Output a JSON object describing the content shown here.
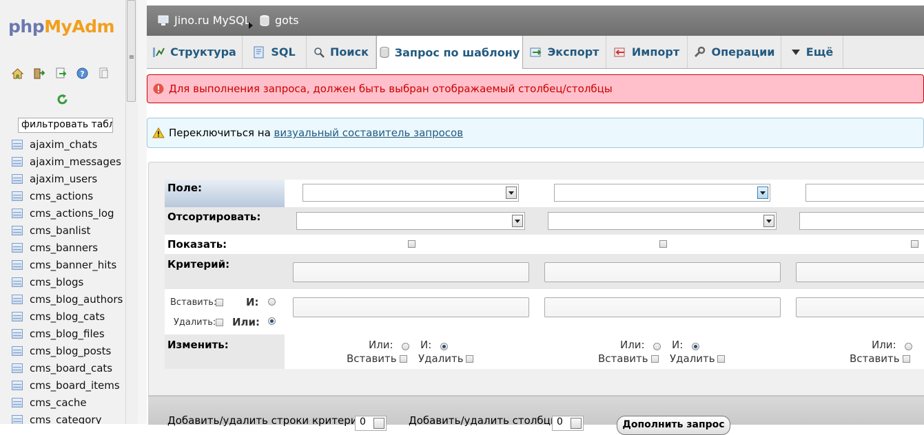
{
  "logo": {
    "part1": "php",
    "part2": "MyAdm"
  },
  "nav": {
    "filter_value": "фильтровать табл",
    "tables": [
      "ajaxim_chats",
      "ajaxim_messages",
      "ajaxim_users",
      "cms_actions",
      "cms_actions_log",
      "cms_banlist",
      "cms_banners",
      "cms_banner_hits",
      "cms_blogs",
      "cms_blog_authors",
      "cms_blog_cats",
      "cms_blog_files",
      "cms_blog_posts",
      "cms_board_cats",
      "cms_board_items",
      "cms_cache",
      "cms_category"
    ]
  },
  "breadcrumb": {
    "server": "Jino.ru MySQL",
    "database": "gots"
  },
  "tabs": [
    {
      "label": "Структура",
      "icon": "structure-icon"
    },
    {
      "label": "SQL",
      "icon": "sql-icon"
    },
    {
      "label": "Поиск",
      "icon": "search-icon"
    },
    {
      "label": "Запрос по шаблону",
      "icon": "query-icon",
      "active": true
    },
    {
      "label": "Экспорт",
      "icon": "export-icon"
    },
    {
      "label": "Импорт",
      "icon": "import-icon"
    },
    {
      "label": "Операции",
      "icon": "operations-icon"
    },
    {
      "label": "Ещё",
      "icon": "more-icon"
    }
  ],
  "messages": {
    "error": "Для выполнения запроса, должен быть выбран отображаемый столбец/столбцы",
    "notice_prefix": "Переключиться на",
    "notice_link": "визуальный составитель запросов"
  },
  "form": {
    "field_label": "Поле:",
    "sort_label": "Отсортировать:",
    "show_label": "Показать:",
    "criteria_label": "Критерий:",
    "insert_label": "Вставить:",
    "delete_label": "Удалить:",
    "and_label": "И:",
    "or_label": "Или:",
    "modify_label": "Изменить:",
    "col_or": "Или:",
    "col_and": "И:",
    "col_insert": "Вставить",
    "col_delete": "Удалить"
  },
  "bottom": {
    "add_rows_label": "Добавить/удалить строки критериея:",
    "add_rows_value": "0",
    "add_cols_label": "Добавить/удалить столбцы:",
    "add_cols_value": "0",
    "update_button": "Дополнить запрос"
  },
  "colors": {
    "tab_text": "#235a81",
    "error_bg": "#ffc0cb",
    "error_text": "#cc0000",
    "notice_bg": "#ebf8fd",
    "logo_php": "#6c78af",
    "logo_my": "#f29f1d"
  }
}
